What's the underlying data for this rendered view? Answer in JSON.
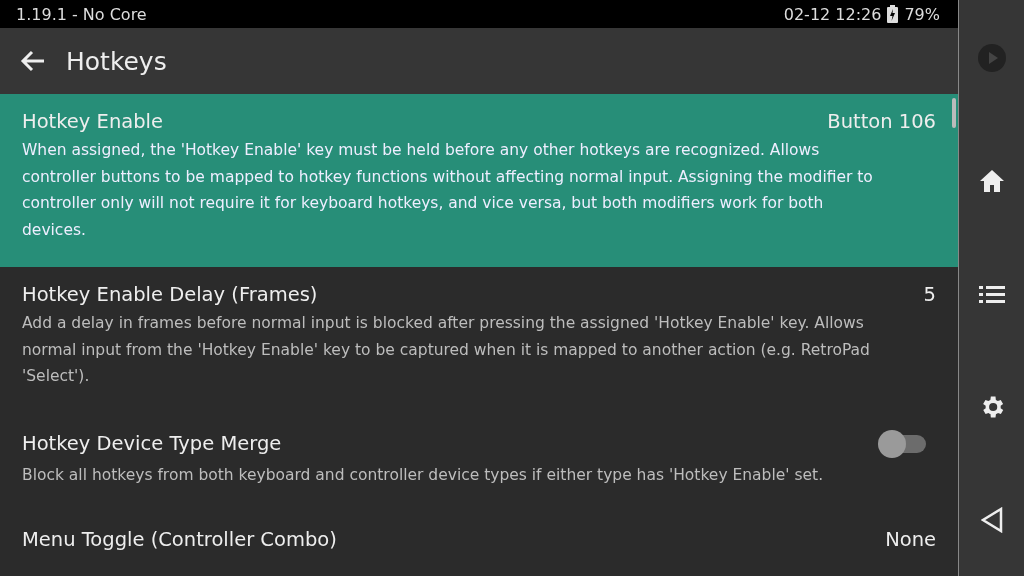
{
  "status_bar": {
    "version": "1.19.1 - No Core",
    "datetime": "02-12 12:26",
    "battery": "79%"
  },
  "header": {
    "title": "Hotkeys"
  },
  "settings": [
    {
      "kind": "value",
      "title": "Hotkey Enable",
      "value": "Button 106",
      "selected": true,
      "description": "When assigned, the 'Hotkey Enable' key must be held before any other hotkeys are recognized. Allows controller buttons to be mapped to hotkey functions without affecting normal input. Assigning the modifier to controller only will not require it for keyboard hotkeys, and vice versa, but both modifiers work for both devices."
    },
    {
      "kind": "value",
      "title": "Hotkey Enable Delay (Frames)",
      "value": "5",
      "selected": false,
      "description": "Add a delay in frames before normal input is blocked after pressing the assigned 'Hotkey Enable' key. Allows normal input from the 'Hotkey Enable' key to be captured when it is mapped to another action (e.g. RetroPad 'Select')."
    },
    {
      "kind": "toggle",
      "title": "Hotkey Device Type Merge",
      "on": false,
      "selected": false,
      "description": "Block all hotkeys from both keyboard and controller device types if either type has 'Hotkey Enable' set."
    },
    {
      "kind": "value",
      "title": "Menu Toggle (Controller Combo)",
      "value": "None",
      "selected": false
    }
  ]
}
